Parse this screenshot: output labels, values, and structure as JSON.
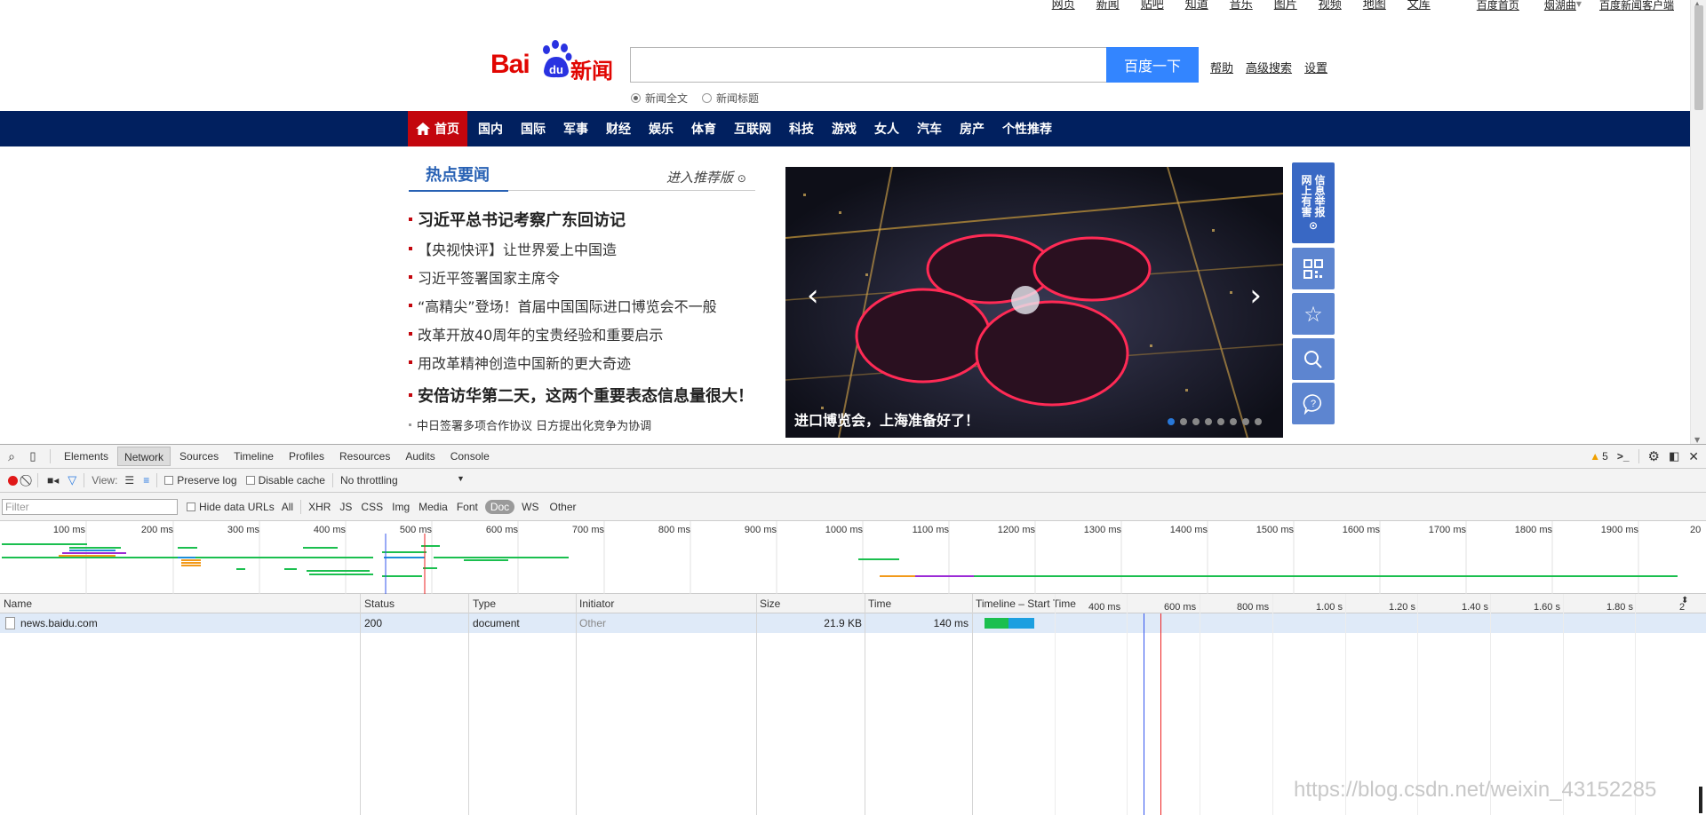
{
  "top_nav": {
    "links": [
      "网页",
      "新闻",
      "贴吧",
      "知道",
      "音乐",
      "图片",
      "视频",
      "地图",
      "文库"
    ],
    "right": [
      "百度首页",
      "烟湖曲",
      "百度新闻客户端"
    ]
  },
  "logo": {
    "bai": "Bai",
    "du": "du",
    "news": "新闻"
  },
  "search": {
    "button": "百度一下",
    "links": [
      "帮助",
      "高级搜索",
      "设置"
    ],
    "radio_all": "新闻全文",
    "radio_title": "新闻标题"
  },
  "channels": {
    "home": "首页",
    "items": [
      "国内",
      "国际",
      "军事",
      "财经",
      "娱乐",
      "体育",
      "互联网",
      "科技",
      "游戏",
      "女人",
      "汽车",
      "房产",
      "个性推荐"
    ]
  },
  "hot": {
    "title": "热点要闻",
    "more": "进入推荐版",
    "items": [
      "习近平总书记考察广东回访记",
      "【央视快评】让世界爱上中国造",
      "习近平签署国家主席令",
      "“高精尖”登场！首届中国国际进口博览会不一般",
      "改革开放40周年的宝贵经验和重要启示",
      "用改革精神创造中国新的更大奇迹",
      "安倍访华第二天，这两个重要表态信息量很大！",
      "中日签署多项合作协议 日方提出化竞争为协调"
    ]
  },
  "slide": {
    "caption": "进口博览会，上海准备好了！"
  },
  "side_tools": {
    "report": [
      "网",
      "上",
      "有",
      "害",
      "信",
      "息",
      "举",
      "报"
    ]
  },
  "devtools": {
    "tabs": [
      "Elements",
      "Network",
      "Sources",
      "Timeline",
      "Profiles",
      "Resources",
      "Audits",
      "Console"
    ],
    "warnings": "5",
    "view_label": "View:",
    "preserve_log": "Preserve log",
    "disable_cache": "Disable cache",
    "throttling": "No throttling",
    "filter_placeholder": "Filter",
    "hide_data_urls": "Hide data URLs",
    "filter_types": [
      "All",
      "XHR",
      "JS",
      "CSS",
      "Img",
      "Media",
      "Font",
      "Doc",
      "WS",
      "Other"
    ],
    "overview_ticks": [
      "100 ms",
      "200 ms",
      "300 ms",
      "400 ms",
      "500 ms",
      "600 ms",
      "700 ms",
      "800 ms",
      "900 ms",
      "1000 ms",
      "1100 ms",
      "1200 ms",
      "1300 ms",
      "1400 ms",
      "1500 ms",
      "1600 ms",
      "1700 ms",
      "1800 ms",
      "1900 ms",
      "20"
    ],
    "columns": [
      "Name",
      "Status",
      "Type",
      "Initiator",
      "Size",
      "Time",
      "Timeline – Start Time"
    ],
    "timeline_ticks": [
      "400 ms",
      "600 ms",
      "800 ms",
      "1.00 s",
      "1.20 s",
      "1.40 s",
      "1.60 s",
      "1.80 s",
      "2"
    ],
    "rows": [
      {
        "name": "news.baidu.com",
        "status": "200",
        "type": "document",
        "initiator": "Other",
        "size": "21.9 KB",
        "time": "140 ms"
      }
    ]
  },
  "watermark": "https://blog.csdn.net/weixin_43152285"
}
